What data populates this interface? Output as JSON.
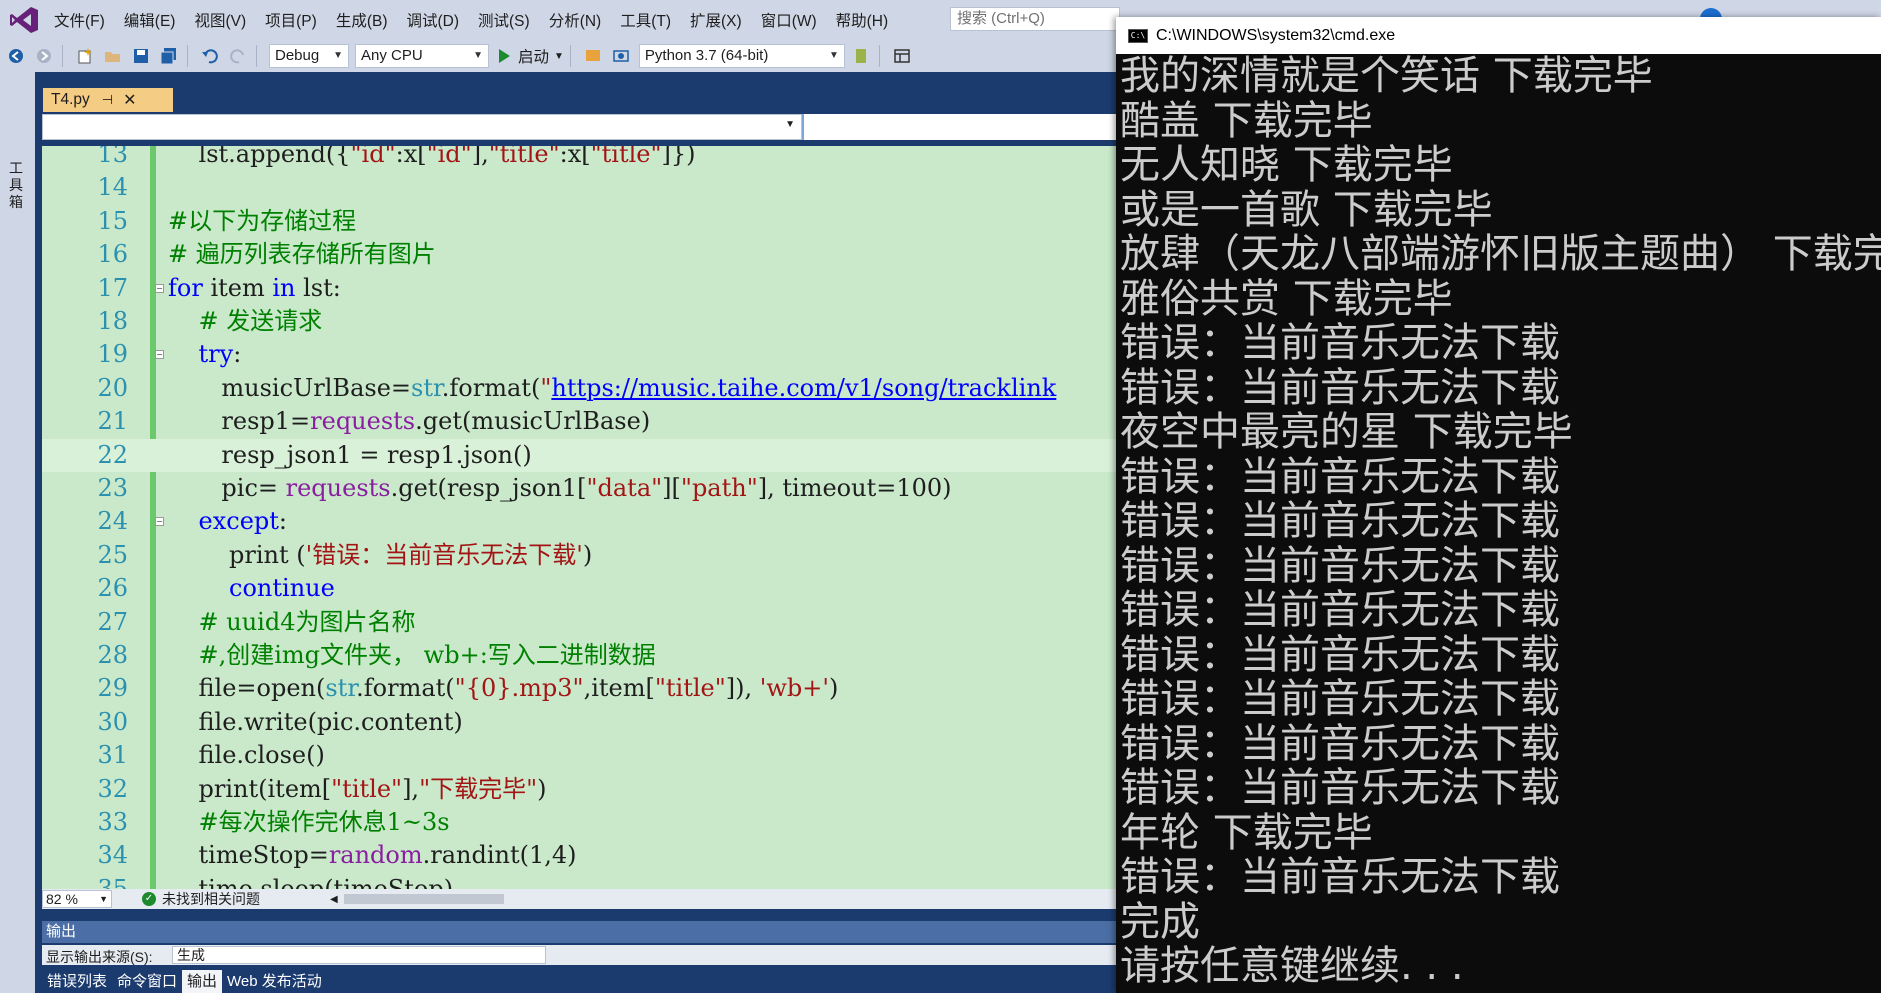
{
  "menubar": {
    "items": [
      "文件(F)",
      "编辑(E)",
      "视图(V)",
      "项目(P)",
      "生成(B)",
      "调试(D)",
      "测试(S)",
      "分析(N)",
      "工具(T)",
      "扩展(X)",
      "窗口(W)",
      "帮助(H)"
    ],
    "search_placeholder": "搜索 (Ctrl+Q)"
  },
  "toolbar": {
    "config": "Debug",
    "platform": "Any CPU",
    "start_label": "启动",
    "python_env": "Python 3.7 (64-bit)"
  },
  "toolbox_label": "工具箱",
  "doc_tab": {
    "name": "T4.py",
    "pin": "⊣",
    "close": "✕"
  },
  "code_lines": [
    {
      "num": "13",
      "indent": 0,
      "parts": [
        {
          "t": "    lst.append({",
          "c": ""
        },
        {
          "t": "\"id\"",
          "c": "st"
        },
        {
          "t": ":x[",
          "c": ""
        },
        {
          "t": "\"id\"",
          "c": "st"
        },
        {
          "t": "],",
          "c": ""
        },
        {
          "t": "\"title\"",
          "c": "st"
        },
        {
          "t": ":x[",
          "c": ""
        },
        {
          "t": "\"title\"",
          "c": "st"
        },
        {
          "t": "]})",
          "c": ""
        }
      ]
    },
    {
      "num": "14",
      "indent": 0,
      "parts": []
    },
    {
      "num": "15",
      "indent": 0,
      "parts": [
        {
          "t": "#以下为存储过程",
          "c": "cm"
        }
      ]
    },
    {
      "num": "16",
      "indent": 0,
      "parts": [
        {
          "t": "# 遍历列表存储所有图片",
          "c": "cm"
        }
      ]
    },
    {
      "num": "17",
      "indent": 0,
      "fold": true,
      "parts": [
        {
          "t": "for",
          "c": "kw"
        },
        {
          "t": " item ",
          "c": ""
        },
        {
          "t": "in",
          "c": "kw"
        },
        {
          "t": " lst:",
          "c": ""
        }
      ]
    },
    {
      "num": "18",
      "indent": 0,
      "parts": [
        {
          "t": "    ",
          "c": ""
        },
        {
          "t": "# 发送请求",
          "c": "cm"
        }
      ]
    },
    {
      "num": "19",
      "indent": 0,
      "fold": true,
      "parts": [
        {
          "t": "    ",
          "c": ""
        },
        {
          "t": "try",
          "c": "kw"
        },
        {
          "t": ":",
          "c": ""
        }
      ]
    },
    {
      "num": "20",
      "indent": 0,
      "parts": [
        {
          "t": "       musicUrlBase=",
          "c": ""
        },
        {
          "t": "str",
          "c": "bi"
        },
        {
          "t": ".format(",
          "c": ""
        },
        {
          "t": "\"",
          "c": "st"
        },
        {
          "t": "https://music.taihe.com/v1/song/tracklink",
          "c": "lnk"
        }
      ]
    },
    {
      "num": "21",
      "indent": 0,
      "parts": [
        {
          "t": "       resp1=",
          "c": ""
        },
        {
          "t": "requests",
          "c": "lib"
        },
        {
          "t": ".get(musicUrlBase)",
          "c": ""
        }
      ]
    },
    {
      "num": "22",
      "indent": 0,
      "current": true,
      "parts": [
        {
          "t": "       resp_json1 = resp1.json()",
          "c": ""
        }
      ]
    },
    {
      "num": "23",
      "indent": 0,
      "parts": [
        {
          "t": "       pic= ",
          "c": ""
        },
        {
          "t": "requests",
          "c": "lib"
        },
        {
          "t": ".get(resp_json1[",
          "c": ""
        },
        {
          "t": "\"data\"",
          "c": "st"
        },
        {
          "t": "][",
          "c": ""
        },
        {
          "t": "\"path\"",
          "c": "st"
        },
        {
          "t": "], timeout=100)",
          "c": ""
        }
      ]
    },
    {
      "num": "24",
      "indent": 0,
      "fold": true,
      "parts": [
        {
          "t": "    ",
          "c": ""
        },
        {
          "t": "except",
          "c": "kw"
        },
        {
          "t": ":",
          "c": ""
        }
      ]
    },
    {
      "num": "25",
      "indent": 0,
      "parts": [
        {
          "t": "        print (",
          "c": ""
        },
        {
          "t": "'错误：当前音乐无法下载'",
          "c": "st"
        },
        {
          "t": ")",
          "c": ""
        }
      ]
    },
    {
      "num": "26",
      "indent": 0,
      "parts": [
        {
          "t": "        ",
          "c": ""
        },
        {
          "t": "continue",
          "c": "kw"
        }
      ]
    },
    {
      "num": "27",
      "indent": 0,
      "parts": [
        {
          "t": "    ",
          "c": ""
        },
        {
          "t": "# uuid4为图片名称",
          "c": "cm"
        }
      ]
    },
    {
      "num": "28",
      "indent": 0,
      "parts": [
        {
          "t": "    ",
          "c": ""
        },
        {
          "t": "#,创建img文件夹， wb+:写入二进制数据",
          "c": "cm"
        }
      ]
    },
    {
      "num": "29",
      "indent": 0,
      "parts": [
        {
          "t": "    file=open(",
          "c": ""
        },
        {
          "t": "str",
          "c": "bi"
        },
        {
          "t": ".format(",
          "c": ""
        },
        {
          "t": "\"{0}.mp3\"",
          "c": "st"
        },
        {
          "t": ",item[",
          "c": ""
        },
        {
          "t": "\"title\"",
          "c": "st"
        },
        {
          "t": "]), ",
          "c": ""
        },
        {
          "t": "'wb+'",
          "c": "st"
        },
        {
          "t": ")",
          "c": ""
        }
      ]
    },
    {
      "num": "30",
      "indent": 0,
      "parts": [
        {
          "t": "    file.write(pic.content)",
          "c": ""
        }
      ]
    },
    {
      "num": "31",
      "indent": 0,
      "parts": [
        {
          "t": "    file.close()",
          "c": ""
        }
      ]
    },
    {
      "num": "32",
      "indent": 0,
      "parts": [
        {
          "t": "    print(item[",
          "c": ""
        },
        {
          "t": "\"title\"",
          "c": "st"
        },
        {
          "t": "],",
          "c": ""
        },
        {
          "t": "\"下载完毕\"",
          "c": "st"
        },
        {
          "t": ")",
          "c": ""
        }
      ]
    },
    {
      "num": "33",
      "indent": 0,
      "parts": [
        {
          "t": "    ",
          "c": ""
        },
        {
          "t": "#每次操作完休息1~3s",
          "c": "cm"
        }
      ]
    },
    {
      "num": "34",
      "indent": 0,
      "parts": [
        {
          "t": "    timeStop=",
          "c": ""
        },
        {
          "t": "random",
          "c": "lib"
        },
        {
          "t": ".randint(1,4)",
          "c": ""
        }
      ]
    },
    {
      "num": "35",
      "indent": 0,
      "parts": [
        {
          "t": "    time.sleep(timeStop)",
          "c": ""
        }
      ]
    }
  ],
  "editor_status": {
    "zoom": "82 %",
    "issues": "未找到相关问题"
  },
  "output": {
    "title": "输出",
    "source_label": "显示输出来源(S):",
    "source_value": "生成"
  },
  "bottom_tabs": [
    {
      "label": "错误列表",
      "active": false
    },
    {
      "label": "命令窗口",
      "active": false
    },
    {
      "label": "输出",
      "active": true
    },
    {
      "label": "Web 发布活动",
      "active": false
    }
  ],
  "cmd": {
    "title": "C:\\WINDOWS\\system32\\cmd.exe",
    "icon_text": "C:\\",
    "lines": [
      "我的深情就是个笑话 下载完毕",
      "酷盖 下载完毕",
      "无人知晓 下载完毕",
      "或是一首歌 下载完毕",
      "放肆（天龙八部端游怀旧版主题曲） 下载完毕",
      "雅俗共赏 下载完毕",
      "错误：当前音乐无法下载",
      "错误：当前音乐无法下载",
      "夜空中最亮的星 下载完毕",
      "错误：当前音乐无法下载",
      "错误：当前音乐无法下载",
      "错误：当前音乐无法下载",
      "错误：当前音乐无法下载",
      "错误：当前音乐无法下载",
      "错误：当前音乐无法下载",
      "错误：当前音乐无法下载",
      "错误：当前音乐无法下载",
      "年轮 下载完毕",
      "错误：当前音乐无法下载",
      "完成",
      "请按任意键继续. . ."
    ]
  }
}
